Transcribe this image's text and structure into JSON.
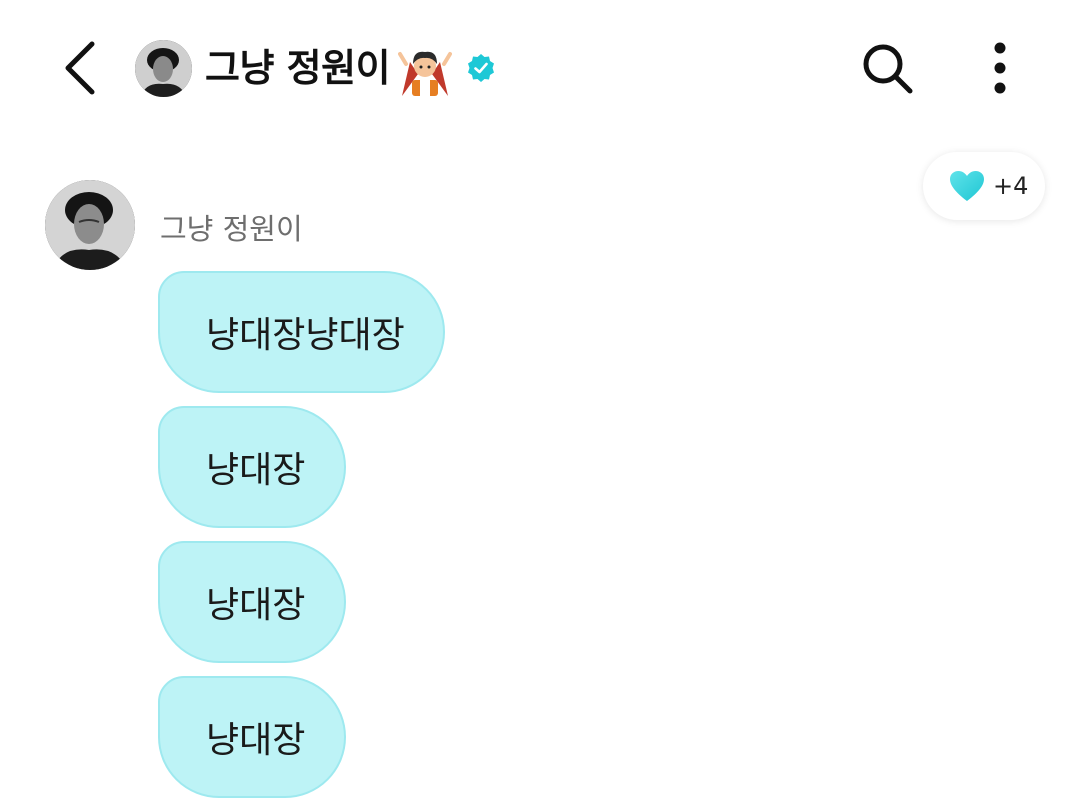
{
  "header": {
    "title": "그냥 정원이",
    "back_icon": "chevron-left-icon",
    "search_icon": "search-icon",
    "more_icon": "more-vertical-icon",
    "title_emoji": "vampire-emoji",
    "verified_color": "#1ec8d6"
  },
  "reaction": {
    "icon": "heart-icon",
    "count": "+4",
    "color": "#2fd2dc"
  },
  "message": {
    "author": "그냥 정원이",
    "bubbles": [
      "냥대장냥대장",
      "냥대장",
      "냥대장",
      "냥대장"
    ],
    "bubble_color": "#bdf3f6"
  }
}
